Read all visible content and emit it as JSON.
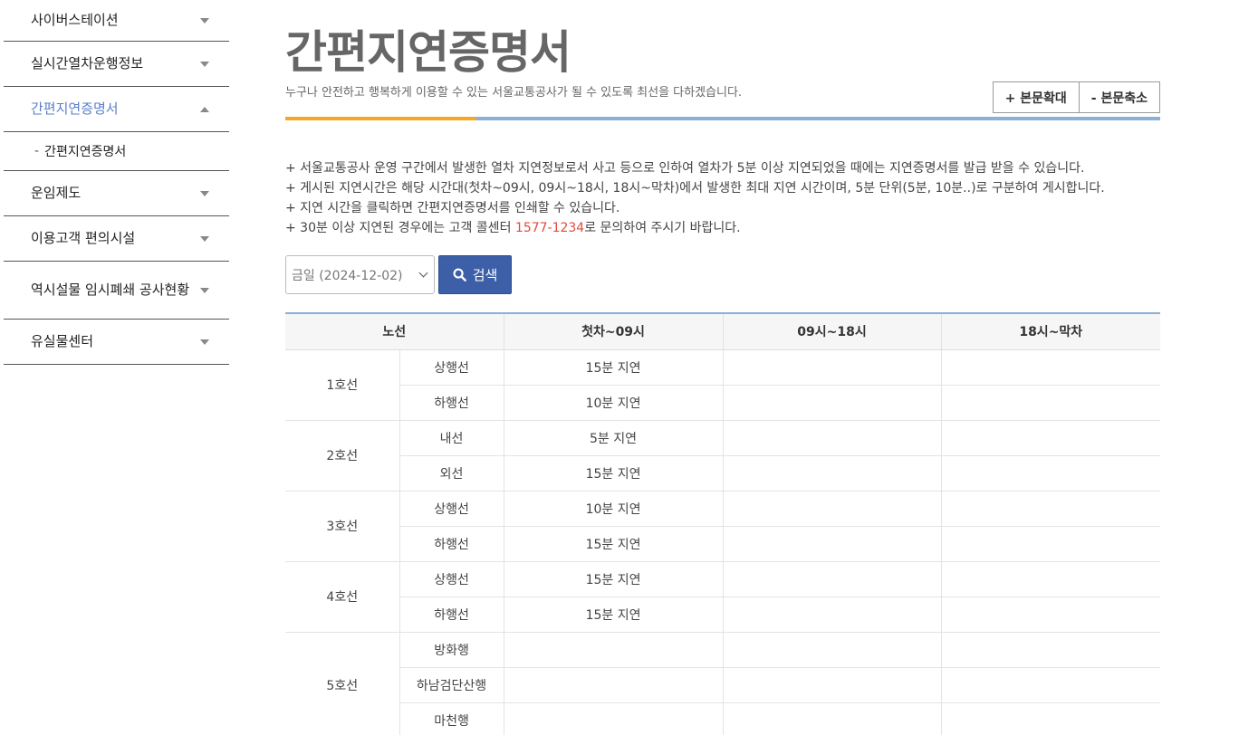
{
  "sidebar": {
    "items": [
      {
        "label": "사이버스테이션"
      },
      {
        "label": "실시간열차운행정보"
      },
      {
        "label": "간편지연증명서"
      },
      {
        "label": "운임제도"
      },
      {
        "label": "이용고객 편의시설"
      },
      {
        "label": "역시설물 임시폐쇄 공사현황"
      },
      {
        "label": "유실물센터"
      }
    ],
    "sub_item": {
      "dash": "-",
      "label": "간편지연증명서"
    }
  },
  "header": {
    "title": "간편지연증명서",
    "subtitle": "누구나 안전하고 행복하게 이용할 수 있는 서울교통공사가 될 수 있도록 최선을 다하겠습니다.",
    "zoom_in": "+ 본문확대",
    "zoom_out": "- 본문축소"
  },
  "notes": {
    "line1": "+ 서울교통공사 운영 구간에서 발생한 열차 지연정보로서 사고 등으로 인하여 열차가 5분 이상 지연되었을 때에는 지연증명서를 발급 받을 수 있습니다.",
    "line2": "+ 게시된 지연시간은 해당 시간대(첫차~09시, 09시~18시, 18시~막차)에서 발생한 최대 지연 시간이며, 5분 단위(5분, 10분..)로 구분하여 게시합니다.",
    "line3": "+ 지연 시간을 클릭하면 간편지연증명서를 인쇄할 수 있습니다.",
    "line4_prefix": "+ 30분 이상 지연된 경우에는 고객 콜센터 ",
    "line4_phone": "1577-1234",
    "line4_suffix": "로 문의하여 주시기 바랍니다."
  },
  "search": {
    "date_select": "금일 (2024-12-02)",
    "button": "검색"
  },
  "table": {
    "headers": [
      "노선",
      "첫차~09시",
      "09시~18시",
      "18시~막차"
    ],
    "lines": [
      {
        "line": "1호선",
        "rows": [
          {
            "dir": "상행선",
            "t1": "15분 지연",
            "t2": "",
            "t3": ""
          },
          {
            "dir": "하행선",
            "t1": "10분 지연",
            "t2": "",
            "t3": ""
          }
        ]
      },
      {
        "line": "2호선",
        "rows": [
          {
            "dir": "내선",
            "t1": "5분 지연",
            "t2": "",
            "t3": ""
          },
          {
            "dir": "외선",
            "t1": "15분 지연",
            "t2": "",
            "t3": ""
          }
        ]
      },
      {
        "line": "3호선",
        "rows": [
          {
            "dir": "상행선",
            "t1": "10분 지연",
            "t2": "",
            "t3": ""
          },
          {
            "dir": "하행선",
            "t1": "15분 지연",
            "t2": "",
            "t3": ""
          }
        ]
      },
      {
        "line": "4호선",
        "rows": [
          {
            "dir": "상행선",
            "t1": "15분 지연",
            "t2": "",
            "t3": ""
          },
          {
            "dir": "하행선",
            "t1": "15분 지연",
            "t2": "",
            "t3": ""
          }
        ]
      },
      {
        "line": "5호선",
        "rows": [
          {
            "dir": "방화행",
            "t1": "",
            "t2": "",
            "t3": ""
          },
          {
            "dir": "하남검단산행",
            "t1": "",
            "t2": "",
            "t3": ""
          },
          {
            "dir": "마천행",
            "t1": "",
            "t2": "",
            "t3": ""
          }
        ]
      }
    ]
  },
  "colors": {
    "accent_blue": "#88b0d9",
    "accent_orange": "#f5a623",
    "active_menu": "#5b7fc7",
    "search_button": "#3d5fa8",
    "phone_highlight": "#e24b3b"
  }
}
